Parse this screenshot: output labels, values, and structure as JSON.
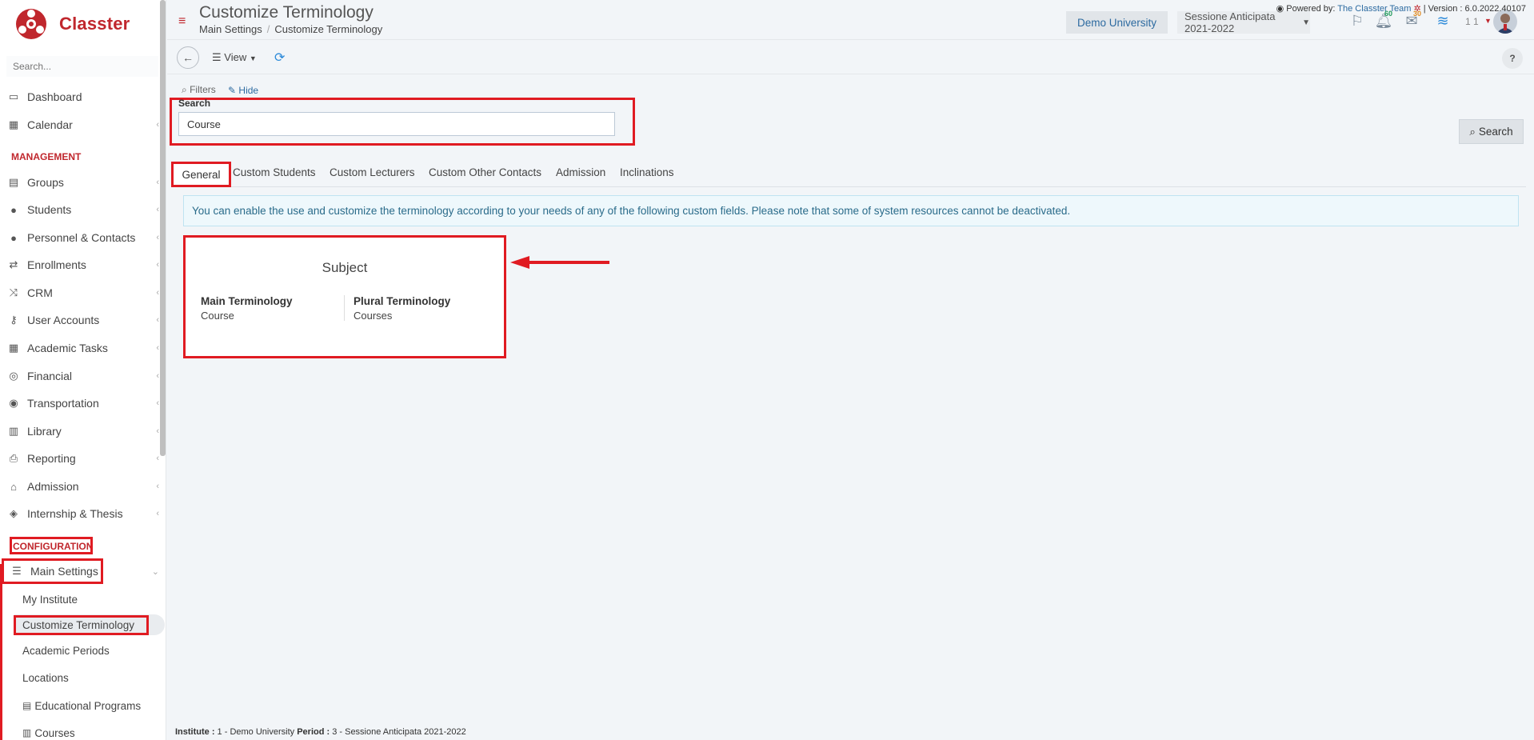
{
  "app": {
    "name": "Classter",
    "search_placeholder": "Search..."
  },
  "sidebar": {
    "items": [
      {
        "label": "Dashboard",
        "icon": "laptop-icon"
      },
      {
        "label": "Calendar",
        "icon": "calendar-icon"
      },
      {
        "label": "Groups",
        "icon": "groups-icon"
      },
      {
        "label": "Students",
        "icon": "students-icon"
      },
      {
        "label": "Personnel & Contacts",
        "icon": "personnel-icon"
      },
      {
        "label": "Enrollments",
        "icon": "exchange-icon"
      },
      {
        "label": "CRM",
        "icon": "shuffle-icon"
      },
      {
        "label": "User Accounts",
        "icon": "key-icon"
      },
      {
        "label": "Academic Tasks",
        "icon": "tasks-icon"
      },
      {
        "label": "Financial",
        "icon": "coins-icon"
      },
      {
        "label": "Transportation",
        "icon": "bus-icon"
      },
      {
        "label": "Library",
        "icon": "library-icon"
      },
      {
        "label": "Reporting",
        "icon": "printer-icon"
      },
      {
        "label": "Admission",
        "icon": "bank-icon"
      },
      {
        "label": "Internship & Thesis",
        "icon": "box-icon"
      }
    ],
    "management_label": "MANAGEMENT",
    "configuration_label": "CONFIGURATION",
    "main_settings": "Main Settings",
    "sub_items": [
      "My Institute",
      "Customize Terminology",
      "Academic Periods",
      "Locations",
      "Educational Programs",
      "Courses"
    ]
  },
  "header": {
    "title": "Customize Terminology",
    "breadcrumb": [
      "Main Settings",
      "Customize Terminology"
    ],
    "university": "Demo University",
    "session": "Sessione Anticipata 2021-2022",
    "notifications_count": "60",
    "messages_count": "30",
    "user_number": "1 1"
  },
  "toolbar": {
    "view_label": "View",
    "help_label": "?"
  },
  "filters": {
    "filters_label": "Filters",
    "hide_label": "Hide",
    "search_label": "Search",
    "search_value": "Course",
    "search_button": "Search"
  },
  "tabs": [
    "General",
    "Custom Students",
    "Custom Lecturers",
    "Custom Other Contacts",
    "Admission",
    "Inclinations"
  ],
  "alert_text": "You can enable the use and customize the terminology according to your needs of any of the following custom fields. Please note that some of system resources cannot be deactivated.",
  "card": {
    "title": "Subject",
    "main_label": "Main Terminology",
    "main_value": "Course",
    "plural_label": "Plural Terminology",
    "plural_value": "Courses"
  },
  "footer": {
    "institute_label": "Institute :",
    "institute_value": " 1 - Demo University ",
    "period_label": "Period :",
    "period_value": " 3 - Sessione Anticipata 2021-2022",
    "powered_label": "Powered by: ",
    "powered_link": "The Classter Team",
    "version": " | Version : 6.0.2022.40107"
  },
  "colors": {
    "brand_red": "#c0272d",
    "highlight_red": "#e01b22",
    "link_blue": "#2c6aa0"
  }
}
